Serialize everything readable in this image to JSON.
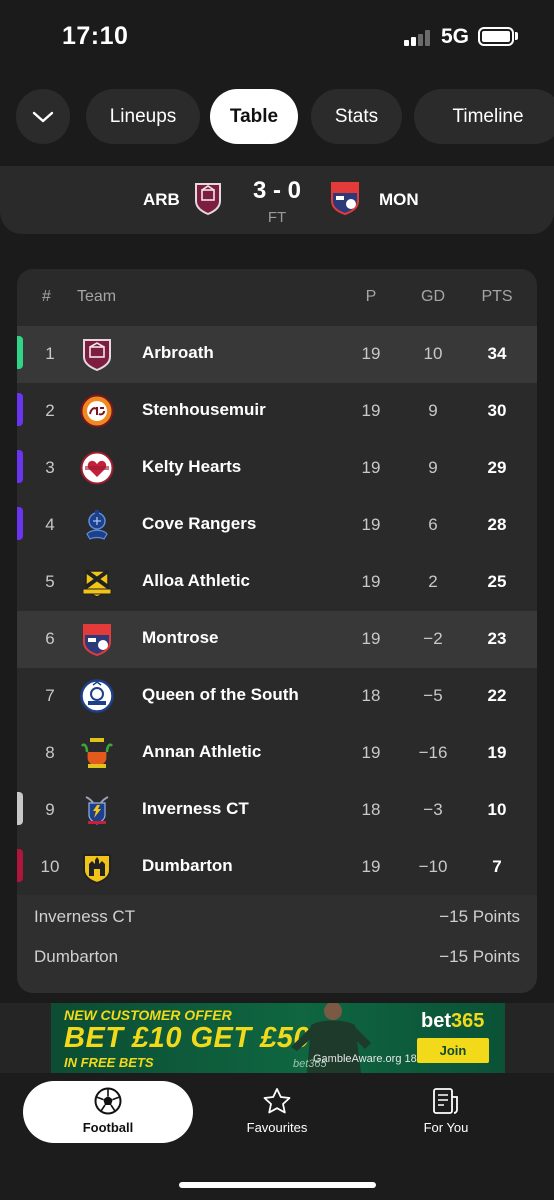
{
  "status_bar": {
    "time": "17:10",
    "network": "5G"
  },
  "tabs": {
    "items": [
      {
        "label": "Lineups",
        "active": false
      },
      {
        "label": "Table",
        "active": true
      },
      {
        "label": "Stats",
        "active": false
      },
      {
        "label": "Timeline",
        "active": false
      }
    ]
  },
  "match": {
    "home": "ARB",
    "away": "MON",
    "score": "3 - 0",
    "status": "FT"
  },
  "table": {
    "headers": {
      "pos": "#",
      "team": "Team",
      "played": "P",
      "gd": "GD",
      "pts": "PTS"
    },
    "rows": [
      {
        "pos": "1",
        "team": "Arbroath",
        "played": "19",
        "gd": "10",
        "pts": "34",
        "zone": "#2fd68a",
        "crest": "arbroath-crest-icon"
      },
      {
        "pos": "2",
        "team": "Stenhousemuir",
        "played": "19",
        "gd": "9",
        "pts": "30",
        "zone": "#6a35f0",
        "crest": "stenhousemuir-crest-icon"
      },
      {
        "pos": "3",
        "team": "Kelty Hearts",
        "played": "19",
        "gd": "9",
        "pts": "29",
        "zone": "#6a35f0",
        "crest": "kelty-hearts-crest-icon"
      },
      {
        "pos": "4",
        "team": "Cove Rangers",
        "played": "19",
        "gd": "6",
        "pts": "28",
        "zone": "#6a35f0",
        "crest": "cove-rangers-crest-icon"
      },
      {
        "pos": "5",
        "team": "Alloa Athletic",
        "played": "19",
        "gd": "2",
        "pts": "25",
        "zone": "",
        "crest": "alloa-athletic-crest-icon"
      },
      {
        "pos": "6",
        "team": "Montrose",
        "played": "19",
        "gd": "−2",
        "pts": "23",
        "zone": "",
        "crest": "montrose-crest-icon"
      },
      {
        "pos": "7",
        "team": "Queen of the South",
        "played": "18",
        "gd": "−5",
        "pts": "22",
        "zone": "",
        "crest": "queen-of-the-south-crest-icon"
      },
      {
        "pos": "8",
        "team": "Annan Athletic",
        "played": "19",
        "gd": "−16",
        "pts": "19",
        "zone": "",
        "crest": "annan-athletic-crest-icon"
      },
      {
        "pos": "9",
        "team": "Inverness CT",
        "played": "18",
        "gd": "−3",
        "pts": "10",
        "zone": "#c8c8c8",
        "crest": "inverness-ct-crest-icon"
      },
      {
        "pos": "10",
        "team": "Dumbarton",
        "played": "19",
        "gd": "−10",
        "pts": "7",
        "zone": "#b0163b",
        "crest": "dumbarton-crest-icon"
      }
    ],
    "highlighted_teams": [
      "Arbroath",
      "Montrose"
    ],
    "deductions": [
      {
        "team": "Inverness CT",
        "value": "−15 Points"
      },
      {
        "team": "Dumbarton",
        "value": "−15 Points"
      }
    ]
  },
  "ad": {
    "line1": "NEW CUSTOMER OFFER",
    "line2": "BET £10 GET £50",
    "line3": "IN FREE BETS",
    "brand_prefix": "bet",
    "brand_number": "365",
    "join": "Join",
    "gamble": "GambleAware.org  18+",
    "watermark": "bet365"
  },
  "bottom_nav": {
    "items": [
      {
        "label": "Football",
        "icon": "football-icon",
        "active": true
      },
      {
        "label": "Favourites",
        "icon": "star-icon",
        "active": false
      },
      {
        "label": "For You",
        "icon": "news-icon",
        "active": false
      }
    ]
  },
  "colors": {
    "background": "#1b1b1b",
    "card": "#2a2a2a",
    "highlight_row": "#383838",
    "accent_yellow": "#f2da1a",
    "ad_green": "#0f6641"
  }
}
